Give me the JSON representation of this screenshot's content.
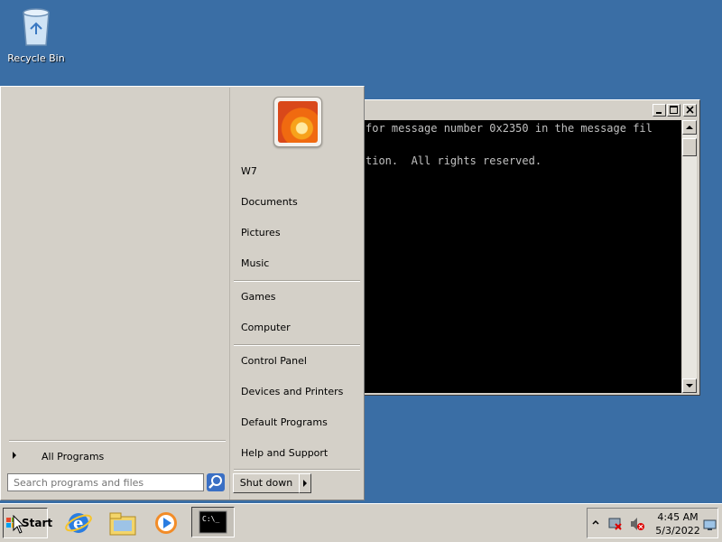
{
  "desktop": {
    "icons": [
      {
        "label": "Recycle Bin",
        "icon": "recycle-bin-icon"
      }
    ],
    "background": "#3a6ea5"
  },
  "console_window": {
    "lines": [
      "for message number 0x2350 in the message fil",
      "tion.  All rights reserved."
    ]
  },
  "start_menu": {
    "user_name": "W7",
    "right_items_group1": [
      "Documents",
      "Pictures",
      "Music"
    ],
    "right_items_group2": [
      "Games",
      "Computer"
    ],
    "right_items_group3": [
      "Control Panel",
      "Devices and Printers",
      "Default Programs",
      "Help and Support"
    ],
    "all_programs": "All Programs",
    "search_placeholder": "Search programs and files",
    "shutdown": "Shut down"
  },
  "taskbar": {
    "start_label": "Start",
    "pinned": [
      {
        "name": "internet-explorer-icon"
      },
      {
        "name": "file-explorer-icon"
      },
      {
        "name": "media-player-icon"
      },
      {
        "name": "command-prompt-icon",
        "active": true
      }
    ],
    "clock_time": "4:45 AM",
    "clock_date": "5/3/2022"
  }
}
